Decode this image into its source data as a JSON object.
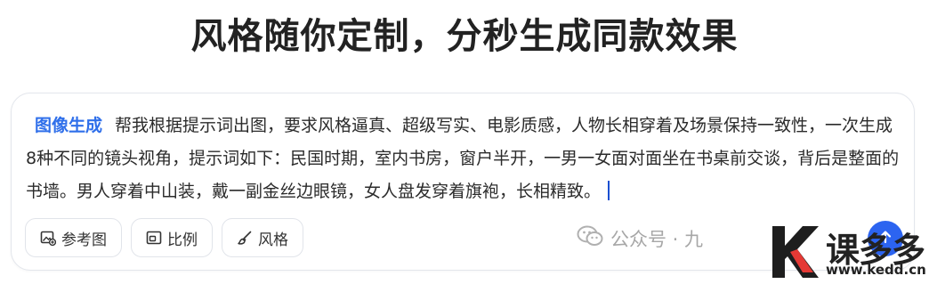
{
  "headline": "风格随你定制，分秒生成同款效果",
  "prompt": {
    "mode_tag": "图像生成",
    "text": "帮我根据提示词出图，要求风格逼真、超级写实、电影质感，人物长相穿着及场景保持一致性，一次生成8种不同的镜头视角，提示词如下：民国时期，室内书房，窗户半开，一男一女面对面坐在书桌前交谈，背后是整面的书墙。男人穿着中山装，戴一副金丝边眼镜，女人盘发穿着旗袍，长相精致。"
  },
  "toolbar": {
    "reference_label": "参考图",
    "ratio_label": "比例",
    "style_label": "风格"
  },
  "send": {
    "icon": "arrow-up-icon"
  },
  "watermark": {
    "text": "公众号 · 九"
  },
  "logo": {
    "text": "课多多",
    "letter": "K",
    "url": "www.kedd.cn",
    "accent_color": "#e53935"
  },
  "colors": {
    "accent": "#2c64f0",
    "mode_tag": "#2f6fea",
    "border": "#e3e6ec"
  }
}
